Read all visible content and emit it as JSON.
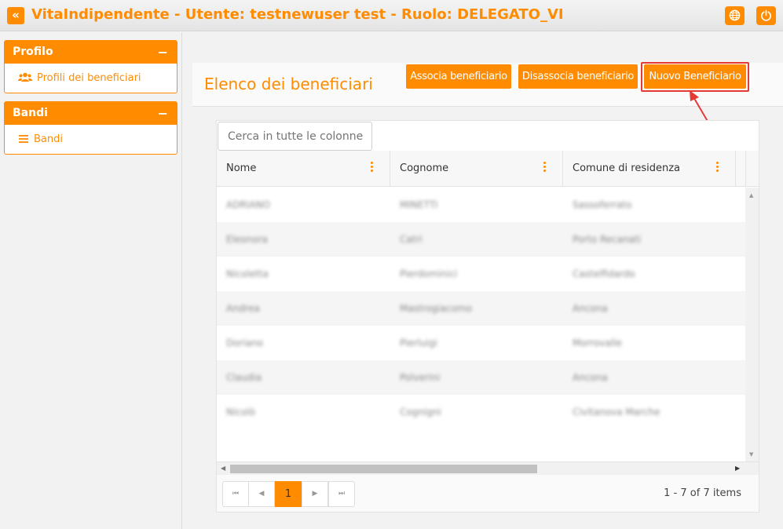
{
  "app": {
    "title": "VitaIndipendente - Utente: testnewuser test - Ruolo: DELEGATO_VI",
    "collapse_glyph": "«",
    "accent_color": "#ff8c00"
  },
  "topbar_icons": {
    "language": "globe-icon",
    "logout": "power-icon"
  },
  "sidebar": {
    "panels": [
      {
        "title": "Profilo",
        "toggle": "−",
        "items": [
          {
            "label": "Profili dei beneficiari",
            "icon": "users-icon"
          }
        ]
      },
      {
        "title": "Bandi",
        "toggle": "−",
        "items": [
          {
            "label": "Bandi",
            "icon": "list-icon"
          }
        ]
      }
    ]
  },
  "main": {
    "title": "Elenco dei beneficiari",
    "buttons": {
      "associa": "Associa beneficiario",
      "disassocia": "Disassocia beneficiario",
      "nuovo": "Nuovo Beneficiario"
    }
  },
  "grid": {
    "search_placeholder": "Cerca in tutte le colonne",
    "columns": [
      "Nome",
      "Cognome",
      "Comune di residenza"
    ],
    "rows": [
      [
        "ADRIANO",
        "MINETTI",
        "Sassoferrato"
      ],
      [
        "Eleonora",
        "Catri",
        "Porto Recanati"
      ],
      [
        "Nicoletta",
        "Pierdominici",
        "Castelfidardo"
      ],
      [
        "Andrea",
        "Mastrogiacomo",
        "Ancona"
      ],
      [
        "Doriano",
        "Pierluigi",
        "Morrovalle"
      ],
      [
        "Claudia",
        "Polverini",
        "Ancona"
      ],
      [
        "Nicolò",
        "Cognigni",
        "Civitanova Marche"
      ]
    ],
    "pager": {
      "first": "⏮",
      "prev": "◀",
      "current_page": "1",
      "next": "▶",
      "last": "⏭",
      "info": "1 - 7 of 7 items"
    }
  }
}
